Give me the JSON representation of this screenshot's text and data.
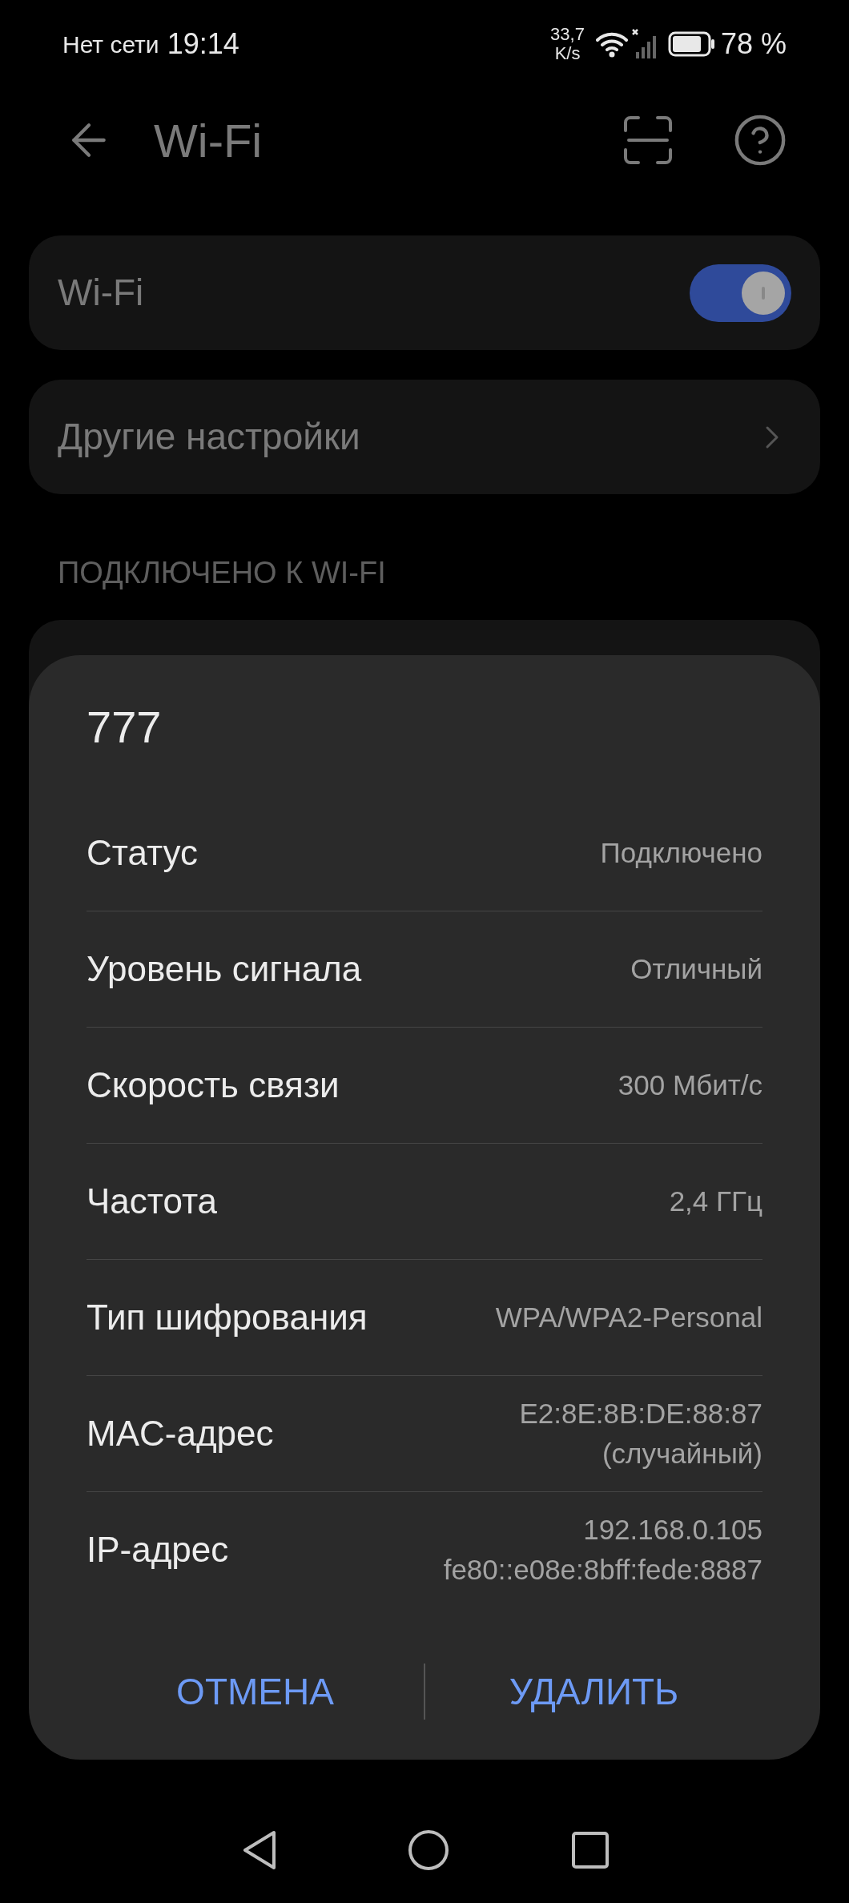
{
  "status_bar": {
    "network": "Нет сети",
    "time": "19:14",
    "speed": "33,7",
    "speed_unit": "K/s",
    "battery": "78 %"
  },
  "header": {
    "title": "Wi-Fi"
  },
  "wifi_toggle": {
    "label": "Wi-Fi",
    "on": true
  },
  "other_settings": {
    "label": "Другие настройки"
  },
  "section": {
    "title": "ПОДКЛЮЧЕНО К WI-FI"
  },
  "dialog": {
    "title": "777",
    "rows": [
      {
        "label": "Статус",
        "values": [
          "Подключено"
        ]
      },
      {
        "label": "Уровень сигнала",
        "values": [
          "Отличный"
        ]
      },
      {
        "label": "Скорость связи",
        "values": [
          "300 Мбит/с"
        ]
      },
      {
        "label": "Частота",
        "values": [
          "2,4 ГГц"
        ]
      },
      {
        "label": "Тип шифрования",
        "values": [
          "WPA/WPA2-Personal"
        ]
      },
      {
        "label": "MAC-адрес",
        "values": [
          "E2:8E:8B:DE:88:87",
          "(случайный)"
        ]
      },
      {
        "label": "IP-адрес",
        "values": [
          "192.168.0.105",
          "fe80::e08e:8bff:fede:8887"
        ]
      }
    ],
    "buttons": [
      "ОТМЕНА",
      "УДАЛИТЬ"
    ]
  }
}
